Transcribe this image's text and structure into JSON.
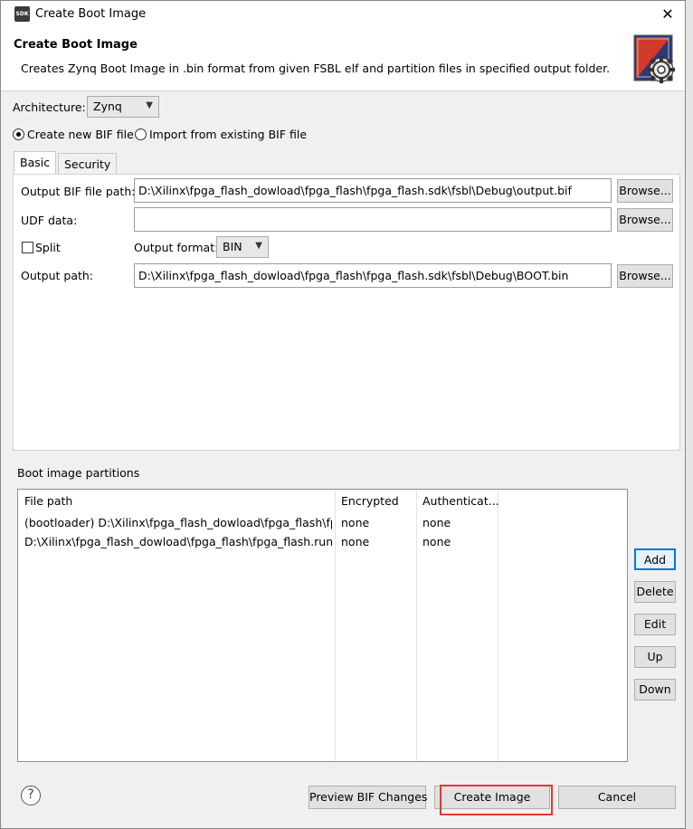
{
  "window": {
    "app_icon_text": "SDK",
    "title": "Create Boot Image",
    "close_glyph": "✕"
  },
  "banner": {
    "title": "Create Boot Image",
    "description": "Creates Zynq Boot Image in .bin format from given FSBL elf and partition files in specified output folder.",
    "icon": "boot-image-gear-icon"
  },
  "architecture": {
    "label": "Architecture:",
    "value": "Zynq"
  },
  "bif_mode": {
    "create_new": "Create new BIF file",
    "import_existing": "Import from existing BIF file",
    "selected": "create_new"
  },
  "tabs": [
    {
      "label": "Basic",
      "active": true
    },
    {
      "label": "Security",
      "active": false
    }
  ],
  "basic": {
    "output_bif_label": "Output BIF file path:",
    "output_bif_value": "D:\\Xilinx\\fpga_flash_dowload\\fpga_flash\\fpga_flash.sdk\\fsbl\\Debug\\output.bif",
    "udf_label": "UDF data:",
    "udf_value": "",
    "split_label": "Split",
    "split_checked": false,
    "output_format_label": "Output format:",
    "output_format_value": "BIN",
    "output_path_label": "Output path:",
    "output_path_value": "D:\\Xilinx\\fpga_flash_dowload\\fpga_flash\\fpga_flash.sdk\\fsbl\\Debug\\BOOT.bin",
    "browse_label": "Browse..."
  },
  "partitions": {
    "label": "Boot image partitions",
    "columns": [
      "File path",
      "Encrypted",
      "Authenticat..."
    ],
    "rows": [
      [
        "(bootloader) D:\\Xilinx\\fpga_flash_dowload\\fpga_flash\\fp...",
        "none",
        "none"
      ],
      [
        "D:\\Xilinx\\fpga_flash_dowload\\fpga_flash\\fpga_flash.runs\\i...",
        "none",
        "none"
      ]
    ],
    "buttons": {
      "add": "Add",
      "delete": "Delete",
      "edit": "Edit",
      "up": "Up",
      "down": "Down"
    }
  },
  "footer": {
    "help_glyph": "?",
    "preview": "Preview BIF Changes",
    "create": "Create Image",
    "cancel": "Cancel"
  },
  "colors": {
    "highlight": "#e53935",
    "default_button_border": "#0078d7"
  }
}
